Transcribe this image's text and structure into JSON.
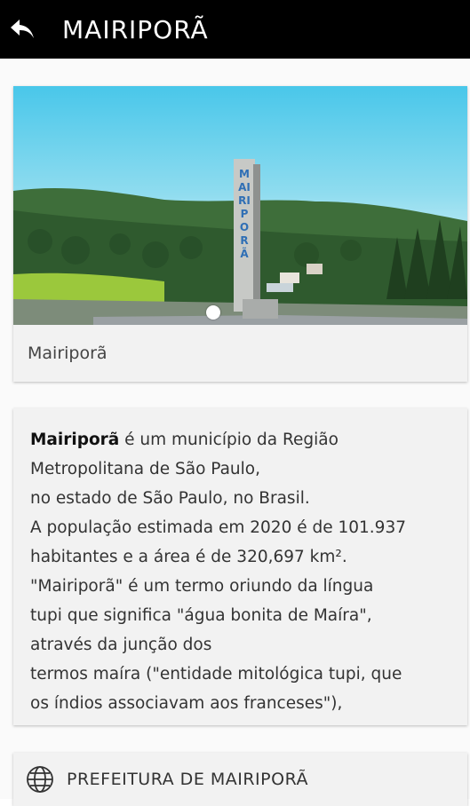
{
  "header": {
    "title": "MAIRIPORÃ",
    "back_icon": "back-arrow-icon"
  },
  "gallery": {
    "caption": "Mairiporã",
    "monument_text": "MAIRIPORÃ",
    "active_slide": 1,
    "slide_count": 1
  },
  "info": {
    "name": "Mairiporã",
    "line1_rest": " é um município da Região",
    "line2": "Metropolitana de São Paulo,",
    "line3": "no estado de São Paulo, no Brasil.",
    "line4": "A população estimada em 2020 é de 101.937",
    "line5": "habitantes e a área é de 320,697 km².",
    "line6": "\"Mairiporã\" é um termo oriundo da língua",
    "line7": "tupi que significa \"água bonita de Maíra\",",
    "line8": "através da junção dos",
    "line9": "termos maíra (\"entidade mitológica tupi, que",
    "line10": "os índios associavam aos franceses\"),"
  },
  "link": {
    "label": "PREFEITURA DE MAIRIPORÃ",
    "icon": "globe-icon"
  }
}
